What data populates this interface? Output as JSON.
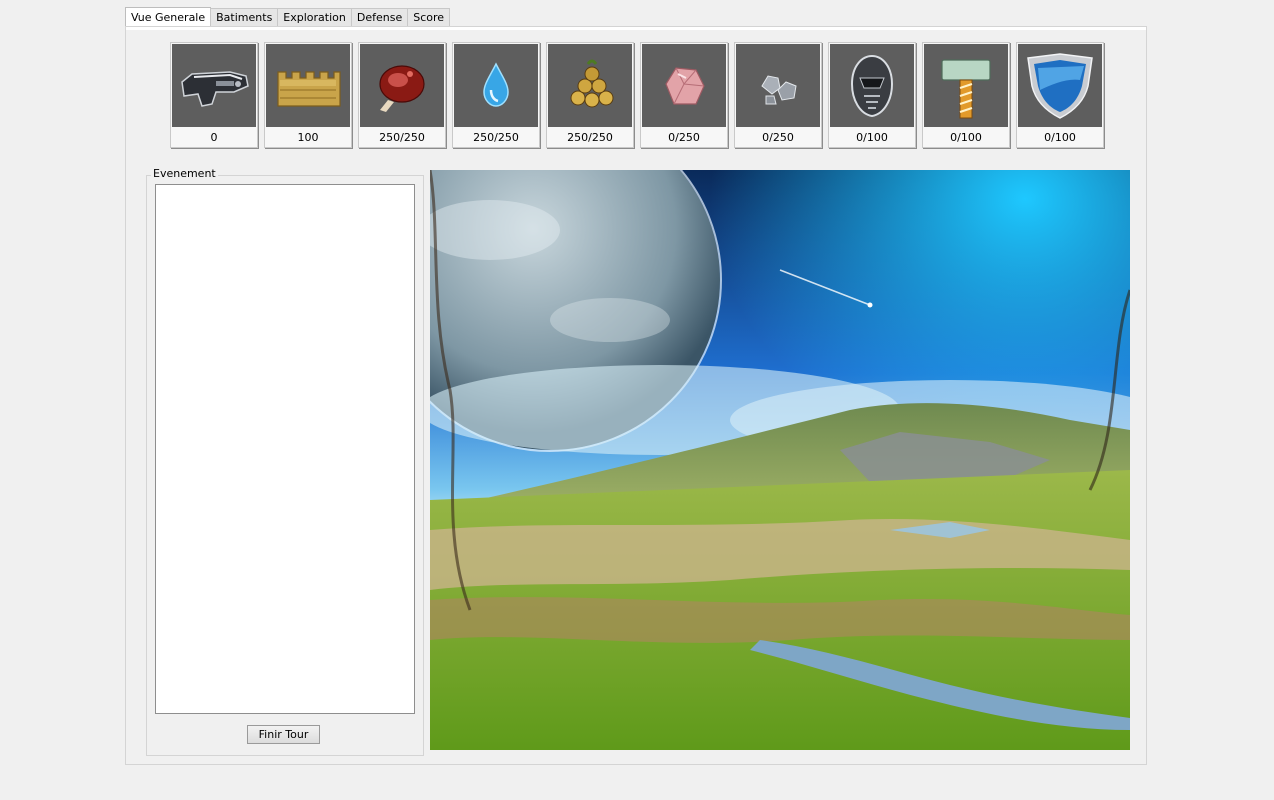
{
  "tabs": [
    {
      "label": "Vue Generale",
      "active": true
    },
    {
      "label": "Batiments",
      "active": false
    },
    {
      "label": "Exploration",
      "active": false
    },
    {
      "label": "Defense",
      "active": false
    },
    {
      "label": "Score",
      "active": false
    }
  ],
  "resources": [
    {
      "icon": "blaster-gun-icon",
      "value": "0"
    },
    {
      "icon": "gold-wall-icon",
      "value": "100"
    },
    {
      "icon": "meat-food-icon",
      "value": "250/250"
    },
    {
      "icon": "water-drop-icon",
      "value": "250/250"
    },
    {
      "icon": "wood-logs-icon",
      "value": "250/250"
    },
    {
      "icon": "pink-crystal-icon",
      "value": "0/250"
    },
    {
      "icon": "metal-ore-icon",
      "value": "0/250"
    },
    {
      "icon": "robot-helmet-icon",
      "value": "0/100"
    },
    {
      "icon": "hammer-icon",
      "value": "0/100"
    },
    {
      "icon": "shield-icon",
      "value": "0/100"
    }
  ],
  "events": {
    "title": "Evenement",
    "log_text": "",
    "end_turn_label": "Finir Tour"
  },
  "colors": {
    "window_bg": "#f0f0f0",
    "tile_bg": "#5e5e5e",
    "log_bg": "#ffffff"
  },
  "scene": {
    "description_icon": "planet-landscape-image"
  }
}
